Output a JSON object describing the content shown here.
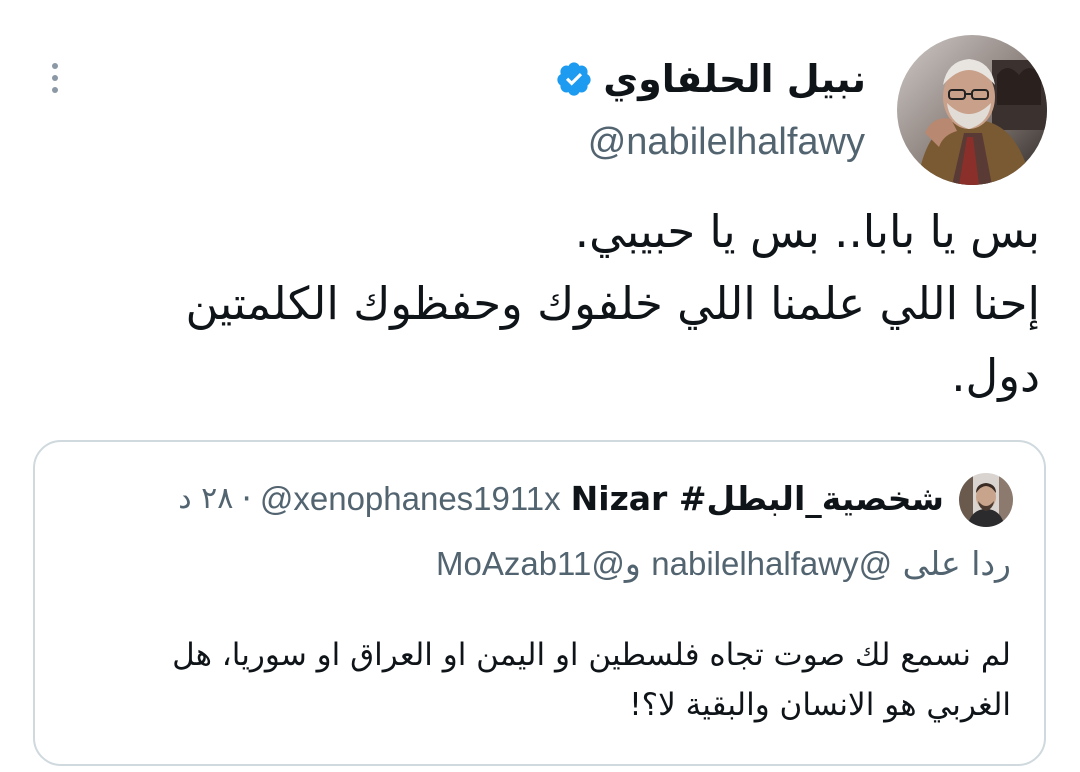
{
  "tweet": {
    "author": {
      "display_name": "نبيل الحلفاوي",
      "handle": "@nabilelhalfawy",
      "verified": true,
      "avatar_icon": "profile-photo"
    },
    "more_icon": "more-vertical-icon",
    "text_lines": [
      "بس يا بابا.. بس يا حبيبي.",
      "إحنا اللي علمنا اللي خلفوك وحفظوك الكلمتين",
      "دول."
    ]
  },
  "quote": {
    "author": {
      "display_name": "شخصية_البطل# Nizar",
      "handle": "@xenophanes1911x",
      "separator": "·",
      "time": "٢٨ د",
      "avatar_icon": "profile-photo"
    },
    "reply_to": {
      "label": "ردا على",
      "mention_1": "@nabilelhalfawy",
      "joiner": "و",
      "mention_2": "@MoAzab11"
    },
    "text_lines": [
      "لم نسمع لك صوت تجاه فلسطين او اليمن او العراق او سوريا،  هل",
      "الغربي هو الانسان والبقية لا؟!"
    ]
  },
  "colors": {
    "text_primary": "#0f1419",
    "text_secondary": "#536471",
    "verified_blue": "#1d9bf0",
    "border": "#cfd9de"
  }
}
